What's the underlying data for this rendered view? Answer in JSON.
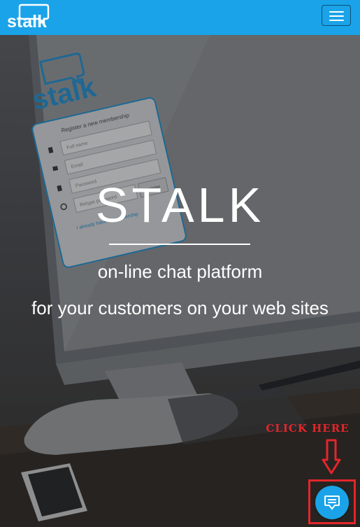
{
  "navbar": {
    "logo_text": "stalk",
    "menu_icon": "hamburger-menu-icon",
    "brand_color": "#1aa3e8"
  },
  "hero": {
    "title": "STALK",
    "line1": "on-line chat platform",
    "line2": "for your customers on your web sites",
    "screen_mockup": {
      "logo_text": "stalk",
      "form_heading": "Register a new membership",
      "full_name_placeholder": "Full name",
      "email_placeholder": "Email",
      "password_placeholder": "Password",
      "retype_placeholder": "Retype password",
      "register_button": "Register",
      "member_link": "I already have a membership"
    }
  },
  "annotation": {
    "click_here": "CLICK HERE",
    "color": "#e3262b"
  },
  "chat_launcher": {
    "icon": "chat-bubble-icon",
    "color": "#1aa3e8"
  }
}
